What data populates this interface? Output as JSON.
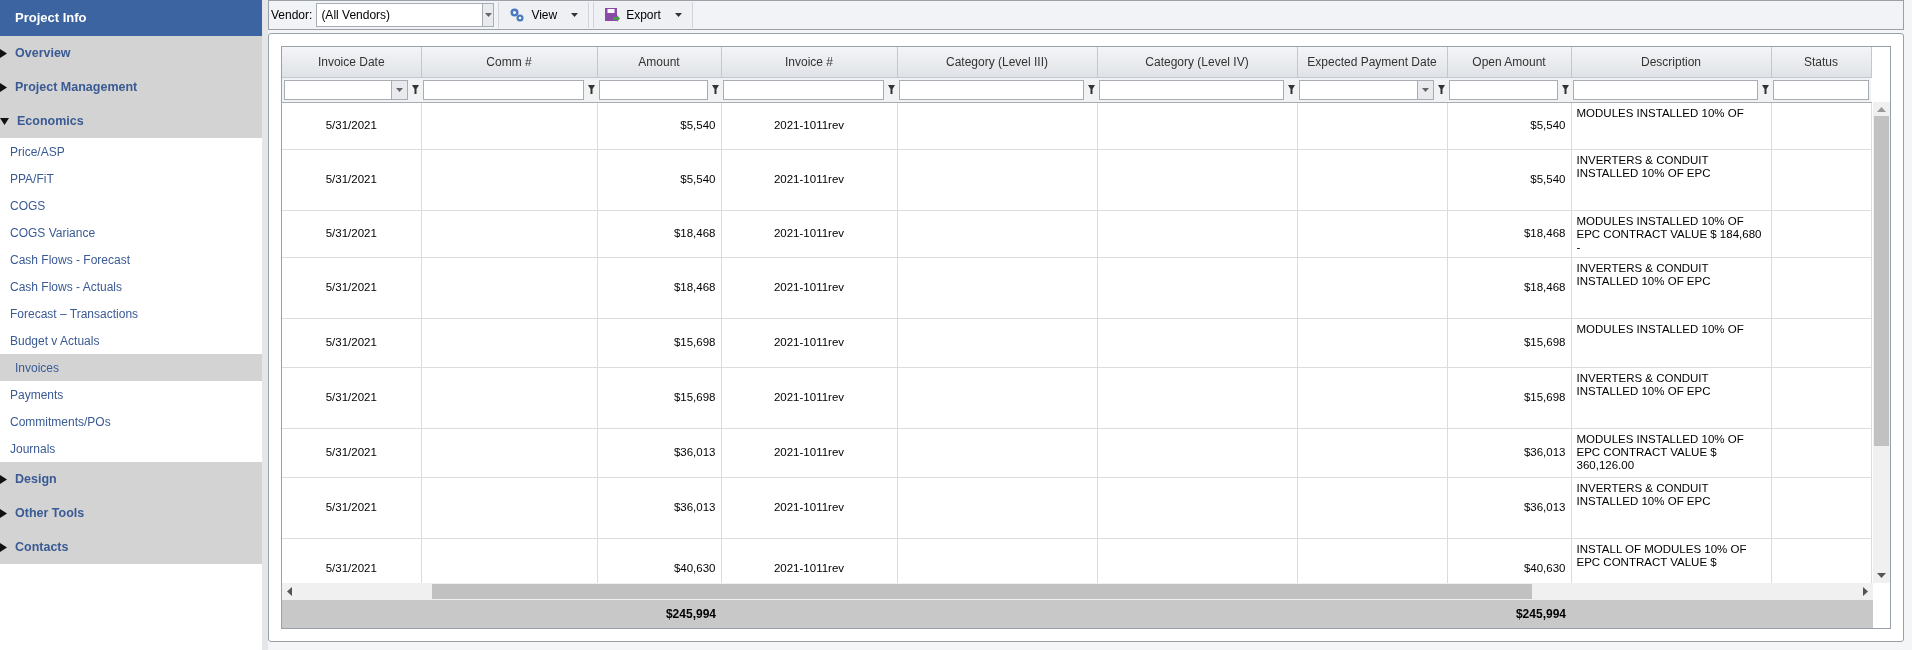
{
  "sidebar": {
    "title": "Project Info",
    "groups": [
      {
        "label": "Overview",
        "expanded": false
      },
      {
        "label": "Project Management",
        "expanded": false
      },
      {
        "label": "Economics",
        "expanded": true,
        "children": [
          {
            "label": "Price/ASP",
            "selected": false
          },
          {
            "label": "PPA/FiT",
            "selected": false
          },
          {
            "label": "COGS",
            "selected": false
          },
          {
            "label": "COGS Variance",
            "selected": false
          },
          {
            "label": "Cash Flows - Forecast",
            "selected": false
          },
          {
            "label": "Cash Flows - Actuals",
            "selected": false
          },
          {
            "label": "Forecast – Transactions",
            "selected": false
          },
          {
            "label": "Budget v Actuals",
            "selected": false
          },
          {
            "label": "Invoices",
            "selected": true
          },
          {
            "label": "Payments",
            "selected": false
          },
          {
            "label": "Commitments/POs",
            "selected": false
          },
          {
            "label": "Journals",
            "selected": false
          }
        ]
      },
      {
        "label": "Design",
        "expanded": false
      },
      {
        "label": "Other Tools",
        "expanded": false
      },
      {
        "label": "Contacts",
        "expanded": false
      }
    ]
  },
  "toolbar": {
    "vendor_label": "Vendor:",
    "vendor_value": "(All Vendors)",
    "buttons": [
      {
        "label": "View",
        "kind": "view"
      },
      {
        "label": "Export",
        "kind": "export"
      }
    ]
  },
  "table": {
    "columns": [
      {
        "label": "Invoice Date"
      },
      {
        "label": "Comm #"
      },
      {
        "label": "Amount"
      },
      {
        "label": "Invoice #"
      },
      {
        "label": "Category (Level III)"
      },
      {
        "label": "Category (Level IV)"
      },
      {
        "label": "Expected Payment Date"
      },
      {
        "label": "Open Amount"
      },
      {
        "label": "Description"
      },
      {
        "label": "Status"
      }
    ],
    "rows": [
      {
        "invoice_date": "5/31/2021",
        "amount": "$5,540",
        "invoice_no": "2021-1011rev",
        "open_amount": "$5,540",
        "description": [
          "MODULES INSTALLED 10% OF"
        ]
      },
      {
        "invoice_date": "5/31/2021",
        "amount": "$5,540",
        "invoice_no": "2021-1011rev",
        "open_amount": "$5,540",
        "description": [
          "INVERTERS & CONDUIT",
          "INSTALLED 10% OF EPC"
        ]
      },
      {
        "invoice_date": "5/31/2021",
        "amount": "$18,468",
        "invoice_no": "2021-1011rev",
        "open_amount": "$18,468",
        "description": [
          "MODULES INSTALLED 10% OF",
          "EPC CONTRACT VALUE $ 184,680",
          "-"
        ]
      },
      {
        "invoice_date": "5/31/2021",
        "amount": "$18,468",
        "invoice_no": "2021-1011rev",
        "open_amount": "$18,468",
        "description": [
          "INVERTERS & CONDUIT",
          "INSTALLED 10% OF EPC"
        ]
      },
      {
        "invoice_date": "5/31/2021",
        "amount": "$15,698",
        "invoice_no": "2021-1011rev",
        "open_amount": "$15,698",
        "description": [
          "MODULES INSTALLED 10% OF"
        ]
      },
      {
        "invoice_date": "5/31/2021",
        "amount": "$15,698",
        "invoice_no": "2021-1011rev",
        "open_amount": "$15,698",
        "description": [
          "INVERTERS & CONDUIT",
          "INSTALLED 10% OF EPC"
        ]
      },
      {
        "invoice_date": "5/31/2021",
        "amount": "$36,013",
        "invoice_no": "2021-1011rev",
        "open_amount": "$36,013",
        "description": [
          "MODULES INSTALLED 10% OF",
          "EPC CONTRACT VALUE $",
          "360,126.00"
        ]
      },
      {
        "invoice_date": "5/31/2021",
        "amount": "$36,013",
        "invoice_no": "2021-1011rev",
        "open_amount": "$36,013",
        "description": [
          "INVERTERS & CONDUIT",
          "INSTALLED 10% OF EPC"
        ]
      },
      {
        "invoice_date": "5/31/2021",
        "amount": "$40,630",
        "invoice_no": "2021-1011rev",
        "open_amount": "$40,630",
        "description": [
          "INSTALL OF MODULES 10% OF",
          "EPC CONTRACT VALUE $"
        ]
      }
    ],
    "totals": {
      "amount": "$245,994",
      "open_amount": "$245,994"
    }
  }
}
